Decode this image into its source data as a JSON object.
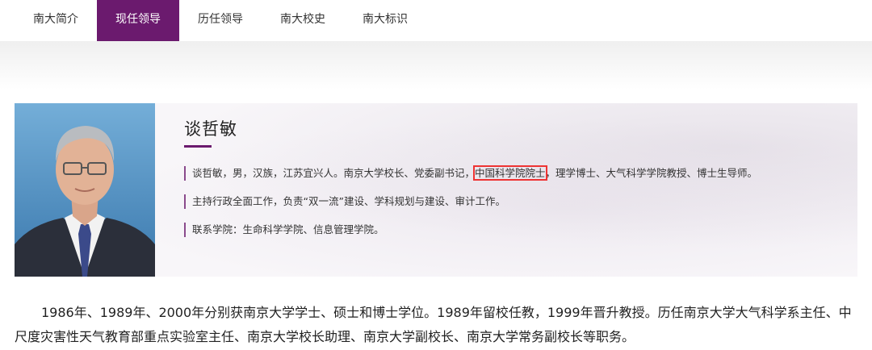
{
  "nav": {
    "items": [
      {
        "label": "南大简介"
      },
      {
        "label": "现任领导"
      },
      {
        "label": "历任领导"
      },
      {
        "label": "南大校史"
      },
      {
        "label": "南大标识"
      }
    ],
    "active_index": 1,
    "active_color": "#6b1a6e"
  },
  "profile": {
    "name": "谈哲敏",
    "line1_before": "谈哲敏，男，汉族，江苏宜兴人。南京大学校长、党委副书记，",
    "line1_highlight": "中国科学院院士",
    "line1_after": "，理学博士、大气科学学院教授、博士生导师。",
    "line2": "主持行政全面工作，负责“双一流”建设、学科规划与建设、审计工作。",
    "line3": "联系学院：生命科学学院、信息管理学院。"
  },
  "bio": {
    "text": "1986年、1989年、2000年分别获南京大学学士、硕士和博士学位。1989年留校任教，1999年晋升教授。历任南京大学大气科学系主任、中尺度灾害性天气教育部重点实验室主任、南京大学校长助理、南京大学副校长、南京大学常务副校长等职务。"
  },
  "colors": {
    "accent": "#6b1a6e",
    "highlight_box": "#e33333"
  }
}
